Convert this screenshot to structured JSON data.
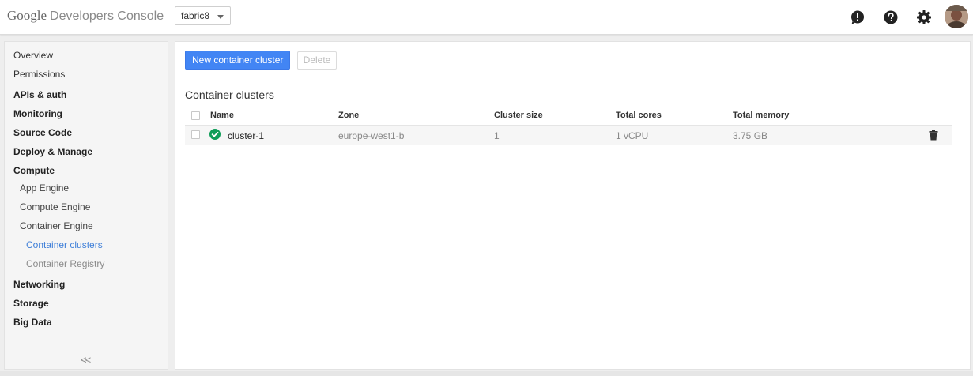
{
  "header": {
    "brand_google": "Google",
    "brand_product": "Developers Console",
    "project": "fabric8",
    "icons": [
      "feedback-icon",
      "help-icon",
      "settings-icon",
      "avatar"
    ]
  },
  "sidebar": {
    "items": [
      {
        "label": "Overview"
      },
      {
        "label": "Permissions"
      },
      {
        "label": "APIs & auth"
      },
      {
        "label": "Monitoring"
      },
      {
        "label": "Source Code"
      },
      {
        "label": "Deploy & Manage"
      },
      {
        "label": "Compute"
      },
      {
        "label": "App Engine"
      },
      {
        "label": "Compute Engine"
      },
      {
        "label": "Container Engine"
      },
      {
        "label": "Container clusters"
      },
      {
        "label": "Container Registry"
      },
      {
        "label": "Networking"
      },
      {
        "label": "Storage"
      },
      {
        "label": "Big Data"
      }
    ],
    "collapse_label": "<<"
  },
  "toolbar": {
    "new_cluster_label": "New container cluster",
    "delete_label": "Delete"
  },
  "main": {
    "section_title": "Container clusters",
    "columns": [
      "Name",
      "Zone",
      "Cluster size",
      "Total cores",
      "Total memory"
    ],
    "rows": [
      {
        "name": "cluster-1",
        "zone": "europe-west1-b",
        "size": "1",
        "cores": "1 vCPU",
        "memory": "3.75 GB",
        "status": "running"
      }
    ]
  },
  "colors": {
    "primary": "#4285f4",
    "active_nav": "#3d7ed8",
    "status_ok": "#0f9d58"
  }
}
